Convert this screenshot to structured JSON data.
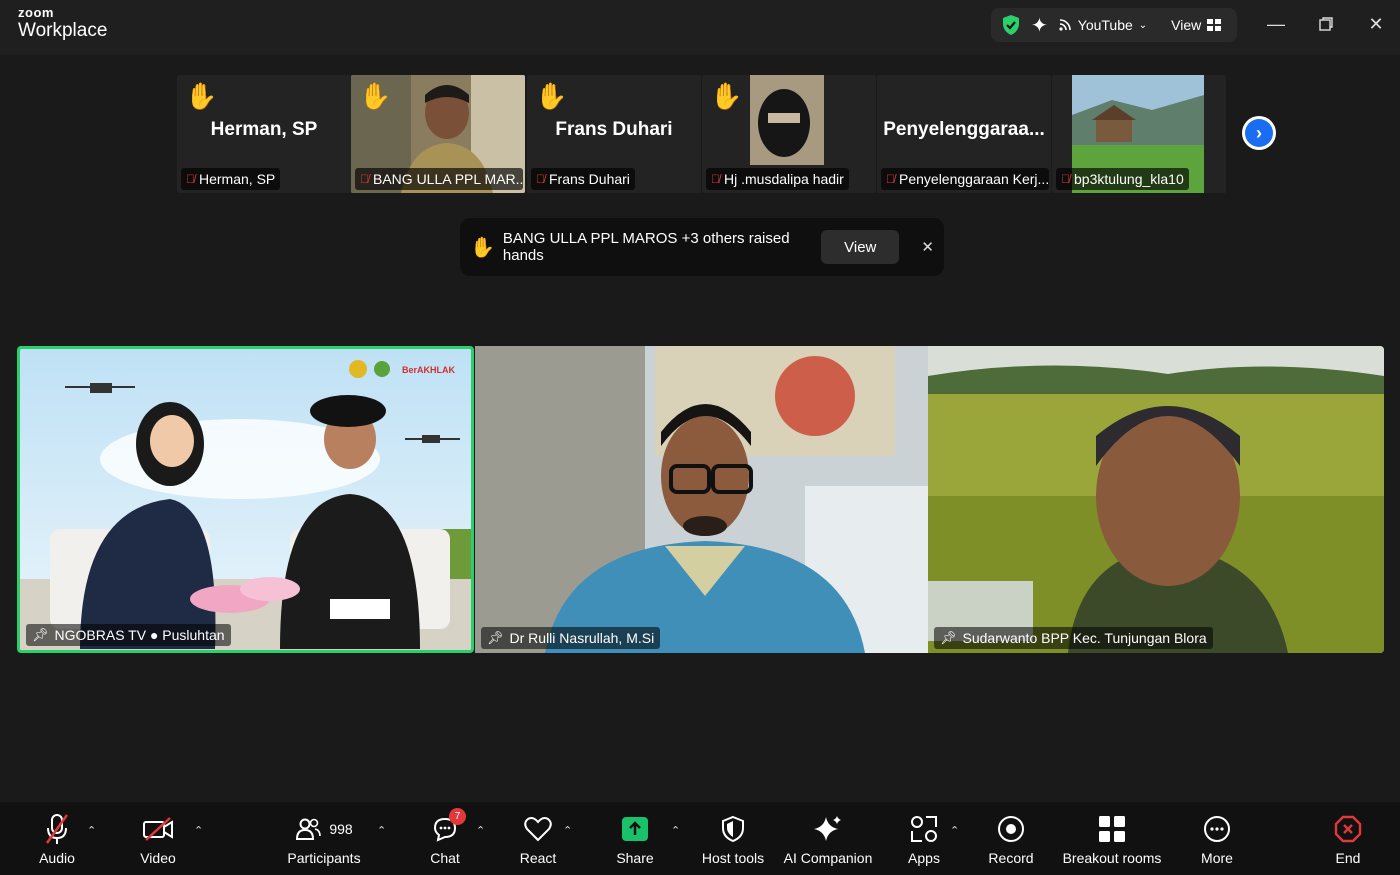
{
  "app": {
    "brand_top": "zoom",
    "brand_bottom": "Workplace"
  },
  "topbar": {
    "youtube_label": "YouTube",
    "view_label": "View"
  },
  "thumbnails": [
    {
      "big_name": "Herman, SP",
      "tag": "Herman, SP",
      "raised": true,
      "type": "name"
    },
    {
      "big_name": "",
      "tag": "BANG ULLA PPL MAR...",
      "raised": true,
      "type": "video-man"
    },
    {
      "big_name": "Frans Duhari",
      "tag": "Frans Duhari",
      "raised": true,
      "type": "name"
    },
    {
      "big_name": "",
      "tag": "Hj .musdalipa  hadir",
      "raised": true,
      "type": "video-hijab"
    },
    {
      "big_name": "Penyelenggaraa...",
      "tag": "Penyelenggaraan Kerj...",
      "raised": false,
      "type": "name"
    },
    {
      "big_name": "",
      "tag": "bp3ktulung_kla10",
      "raised": false,
      "type": "video-landscape"
    }
  ],
  "banner": {
    "text": "BANG ULLA PPL MAROS +3 others raised hands",
    "view_label": "View"
  },
  "tiles": [
    {
      "label": "NGOBRAS TV ● Pusluhtan",
      "logo_text": "BerAKHLAK"
    },
    {
      "label": "Dr Rulli Nasrullah, M.Si"
    },
    {
      "label": "Sudarwanto BPP Kec. Tunjungan Blora"
    }
  ],
  "toolbar": {
    "audio": "Audio",
    "video": "Video",
    "participants": "Participants",
    "participants_count": "998",
    "chat": "Chat",
    "chat_badge": "7",
    "react": "React",
    "share": "Share",
    "host_tools": "Host tools",
    "ai_companion": "AI Companion",
    "apps": "Apps",
    "record": "Record",
    "breakout": "Breakout rooms",
    "more": "More",
    "end": "End"
  },
  "colors": {
    "share_green": "#19c26a",
    "end_red": "#e0383b",
    "active_border": "#2ad16b",
    "accent_blue": "#1a6cf0"
  }
}
